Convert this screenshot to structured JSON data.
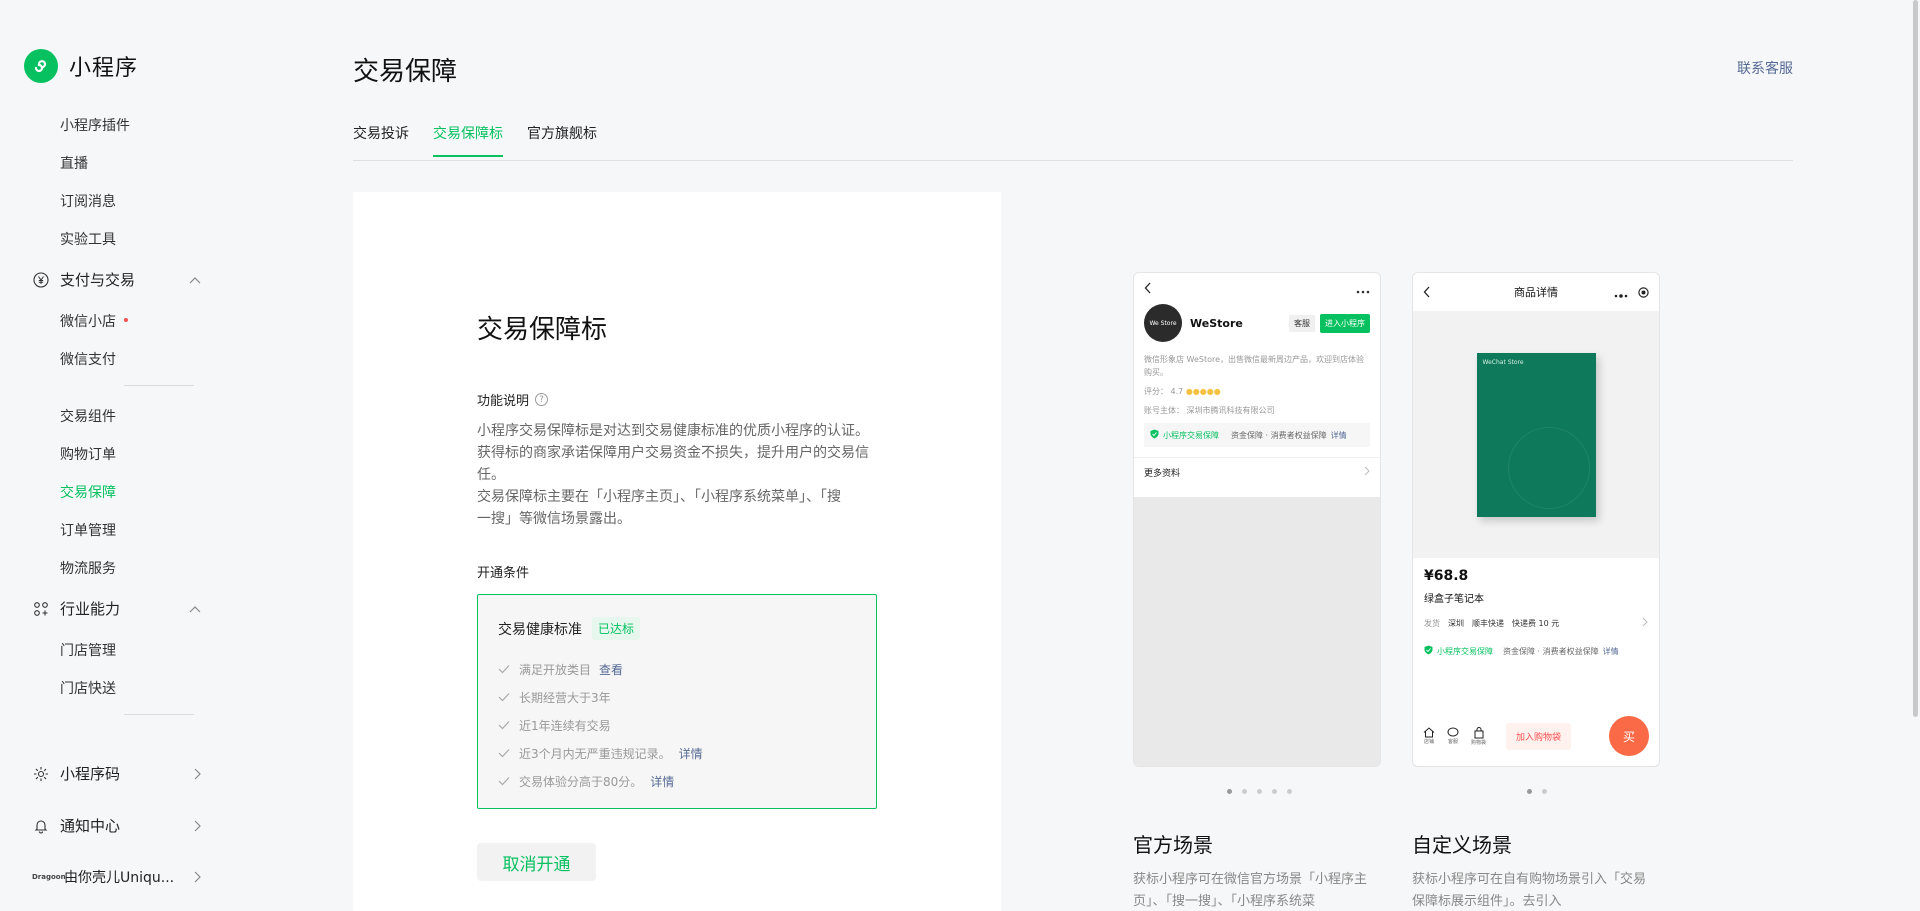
{
  "brand": {
    "name": "小程序"
  },
  "sidebar": {
    "items_top": [
      "小程序插件",
      "直播",
      "订阅消息",
      "实验工具"
    ],
    "group_pay": {
      "label": "支付与交易",
      "icon": "yen-circle-icon"
    },
    "pay_items": [
      "微信小店",
      "微信支付"
    ],
    "trade_items": [
      "交易组件",
      "购物订单",
      "交易保障",
      "订单管理",
      "物流服务"
    ],
    "active_item": "交易保障",
    "group_industry": {
      "label": "行业能力",
      "icon": "industry-icon"
    },
    "industry_items": [
      "门店管理",
      "门店快送"
    ],
    "bottom_items": [
      {
        "label": "小程序码",
        "icon": "qrcode-sun-icon"
      },
      {
        "label": "通知中心",
        "icon": "bell-icon"
      },
      {
        "label": "由你壳儿Uniqu...",
        "logo_text": "Dragoon"
      }
    ]
  },
  "header": {
    "title": "交易保障",
    "contact": "联系客服"
  },
  "tabs": [
    {
      "label": "交易投诉",
      "active": false
    },
    {
      "label": "交易保障标",
      "active": true
    },
    {
      "label": "官方旗舰标",
      "active": false
    }
  ],
  "card": {
    "title": "交易保障标",
    "func_label": "功能说明",
    "func_help": "?",
    "desc_lines": [
      "小程序交易保障标是对达到交易健康标准的优质小程序的认证。",
      "获得标的商家承诺保障用户交易资金不损失，提升用户的交易信",
      "任。",
      "交易保障标主要在「小程序主页」、「小程序系统菜单」、「搜",
      "一搜」等微信场景露出。"
    ],
    "cond_label": "开通条件",
    "cond_head": "交易健康标准",
    "cond_badge": "已达标",
    "conditions": [
      {
        "text": "满足开放类目",
        "link": "查看"
      },
      {
        "text": "长期经营大于3年",
        "link": ""
      },
      {
        "text": "近1年连续有交易",
        "link": ""
      },
      {
        "text": "近3个月内无严重违规记录。",
        "link": "详情"
      },
      {
        "text": "交易体验分高于80分。",
        "link": "详情"
      }
    ],
    "cancel_button": "取消开通"
  },
  "preview_official": {
    "shop_name": "WeStore",
    "logo_text": "We Store",
    "kf_label": "客服",
    "enter_label": "进入小程序",
    "intro": "微信形象店 WeStore，出售微信最新周边产品，欢迎到店体验购买。",
    "rating_label": "评分：",
    "rating": "4.7",
    "entity": "账号主体：  深圳市腾讯科技有限公司",
    "guard_label": "小程序交易保障",
    "guard_sub": "资金保障 · 消费者权益保障",
    "guard_detail": "详情",
    "more": "更多资料",
    "scene_title": "官方场景",
    "scene_desc": "获标小程序可在微信官方场景「小程序主页」、「搜一搜」、「小程序系统菜",
    "dots_total": 5,
    "dots_active": 1
  },
  "preview_custom": {
    "page_title": "商品详情",
    "book_text": "WeChat Store",
    "price": "¥68.8",
    "product": "绿盒子笔记本",
    "ship_label": "发货",
    "ship_city": "深圳",
    "ship_method": "顺丰快递",
    "ship_fee": "快递费 10 元",
    "guard_label": "小程序交易保障",
    "guard_sub": "资金保障 · 消费者权益保障",
    "guard_detail": "详情",
    "bottom": [
      "店铺",
      "客服",
      "购物袋"
    ],
    "add_cart": "加入购物袋",
    "buy": "买",
    "scene_title": "自定义场景",
    "scene_desc": "获标小程序可在自有购物场景引入「交易保障标展示组件」。去引入",
    "dots_total": 2,
    "dots_active": 1
  },
  "colors": {
    "accent": "#07c160",
    "link": "#576b95",
    "buy": "#fa6a46",
    "alert": "#fa5151"
  }
}
